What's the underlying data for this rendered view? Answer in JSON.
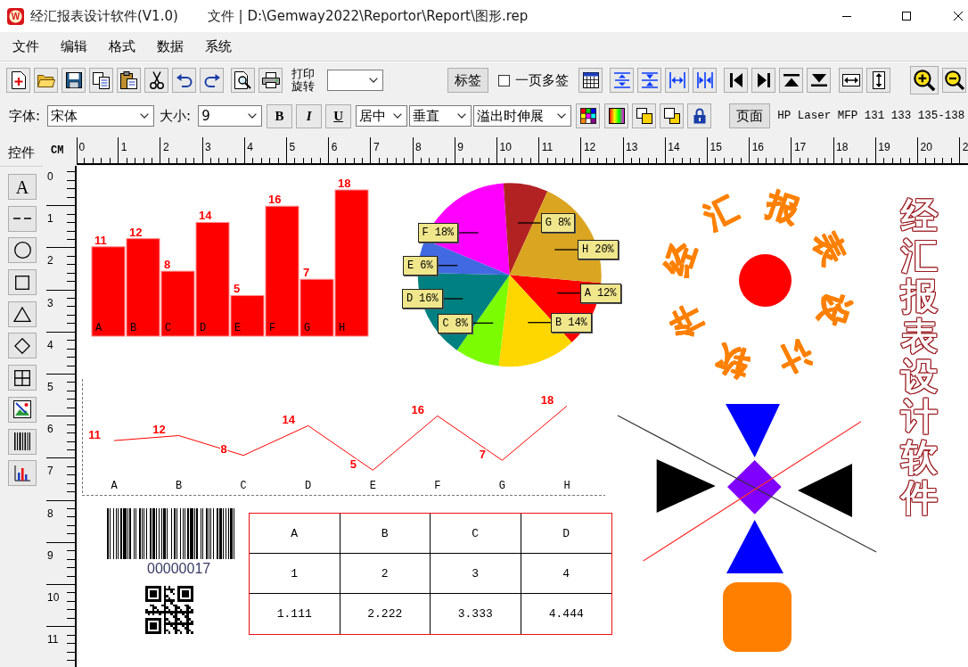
{
  "window": {
    "icon_letter": "W",
    "title": "经汇报表设计软件(V1.0)",
    "document": "文件 | D:\\Gemway2022\\Reportor\\Report\\图形.rep"
  },
  "menu": [
    "文件",
    "编辑",
    "格式",
    "数据",
    "系统"
  ],
  "toolbar": {
    "rotate_print_label": "打印旋转",
    "tag_button": "标签",
    "multi_label": {
      "label": "一页多签",
      "checked": false
    }
  },
  "format_bar": {
    "font_label": "字体:",
    "font": "宋体",
    "size_label": "大小:",
    "size": "9",
    "bold_button": "B",
    "italic_button": "I",
    "underline_button": "U",
    "horizontal_align": "居中",
    "vertical_align": "垂直",
    "overflow_mode": "溢出时伸展",
    "page_button": "页面",
    "printer": "HP Laser MFP 131 133 135-138"
  },
  "toolbox": {
    "title": "控件",
    "tools": [
      {
        "kind": "text",
        "label": "A"
      },
      {
        "kind": "line"
      },
      {
        "kind": "ellipse"
      },
      {
        "kind": "rectangle"
      },
      {
        "kind": "triangle"
      },
      {
        "kind": "diamond"
      },
      {
        "kind": "table"
      },
      {
        "kind": "image"
      },
      {
        "kind": "barcode"
      },
      {
        "kind": "chart"
      }
    ]
  },
  "ruler": {
    "unit": "CM",
    "horizontal": [
      "0",
      "1",
      "2",
      "3",
      "4",
      "5",
      "6",
      "7",
      "8",
      "9",
      "10",
      "11",
      "12",
      "13",
      "14",
      "15",
      "16",
      "17",
      "18",
      "19",
      "20",
      "2"
    ],
    "vertical": [
      "0",
      "1",
      "2",
      "3",
      "4",
      "5",
      "6",
      "7",
      "8",
      "9",
      "10",
      "11"
    ]
  },
  "canvas": {
    "bar_chart": {
      "chart_data": {
        "type": "bar",
        "categories": [
          "A",
          "B",
          "C",
          "D",
          "E",
          "F",
          "G",
          "H"
        ],
        "values": [
          11,
          12,
          8,
          14,
          5,
          16,
          7,
          18
        ],
        "data_labels": true
      }
    },
    "pie_chart": {
      "chart_data": {
        "type": "pie",
        "categories": [
          "A",
          "B",
          "C",
          "D",
          "E",
          "F",
          "G",
          "H"
        ],
        "values": [
          12,
          14,
          8,
          16,
          6,
          18,
          8,
          20
        ],
        "data_labels": true,
        "value_labels": [
          "12%",
          "14%",
          "8%",
          "16%",
          "6%",
          "18%",
          "8%",
          "20%"
        ]
      },
      "slices": [
        {
          "color": "#ff0000"
        },
        {
          "color": "#ffd700"
        },
        {
          "color": "#7cfc00"
        },
        {
          "color": "#008080"
        },
        {
          "color": "#4169e1"
        },
        {
          "color": "#ff00ff"
        },
        {
          "color": "#b22222"
        },
        {
          "color": "#daa520"
        }
      ]
    },
    "circular_text": [
      "经",
      "汇",
      "报",
      "表",
      "设",
      "计",
      "软",
      "件"
    ],
    "vertical_text": "经汇报表设计软件",
    "line_chart": {
      "chart_data": {
        "type": "line",
        "categories": [
          "A",
          "B",
          "C",
          "D",
          "E",
          "F",
          "G",
          "H"
        ],
        "values": [
          11,
          12,
          8,
          14,
          5,
          16,
          7,
          18
        ],
        "data_labels": true
      }
    },
    "barcode": {
      "number": "00000017"
    },
    "table": {
      "rows": [
        [
          "A",
          "B",
          "C",
          "D"
        ],
        [
          "1",
          "2",
          "3",
          "4"
        ],
        [
          "1.111",
          "2.222",
          "3.333",
          "4.444"
        ]
      ]
    }
  }
}
